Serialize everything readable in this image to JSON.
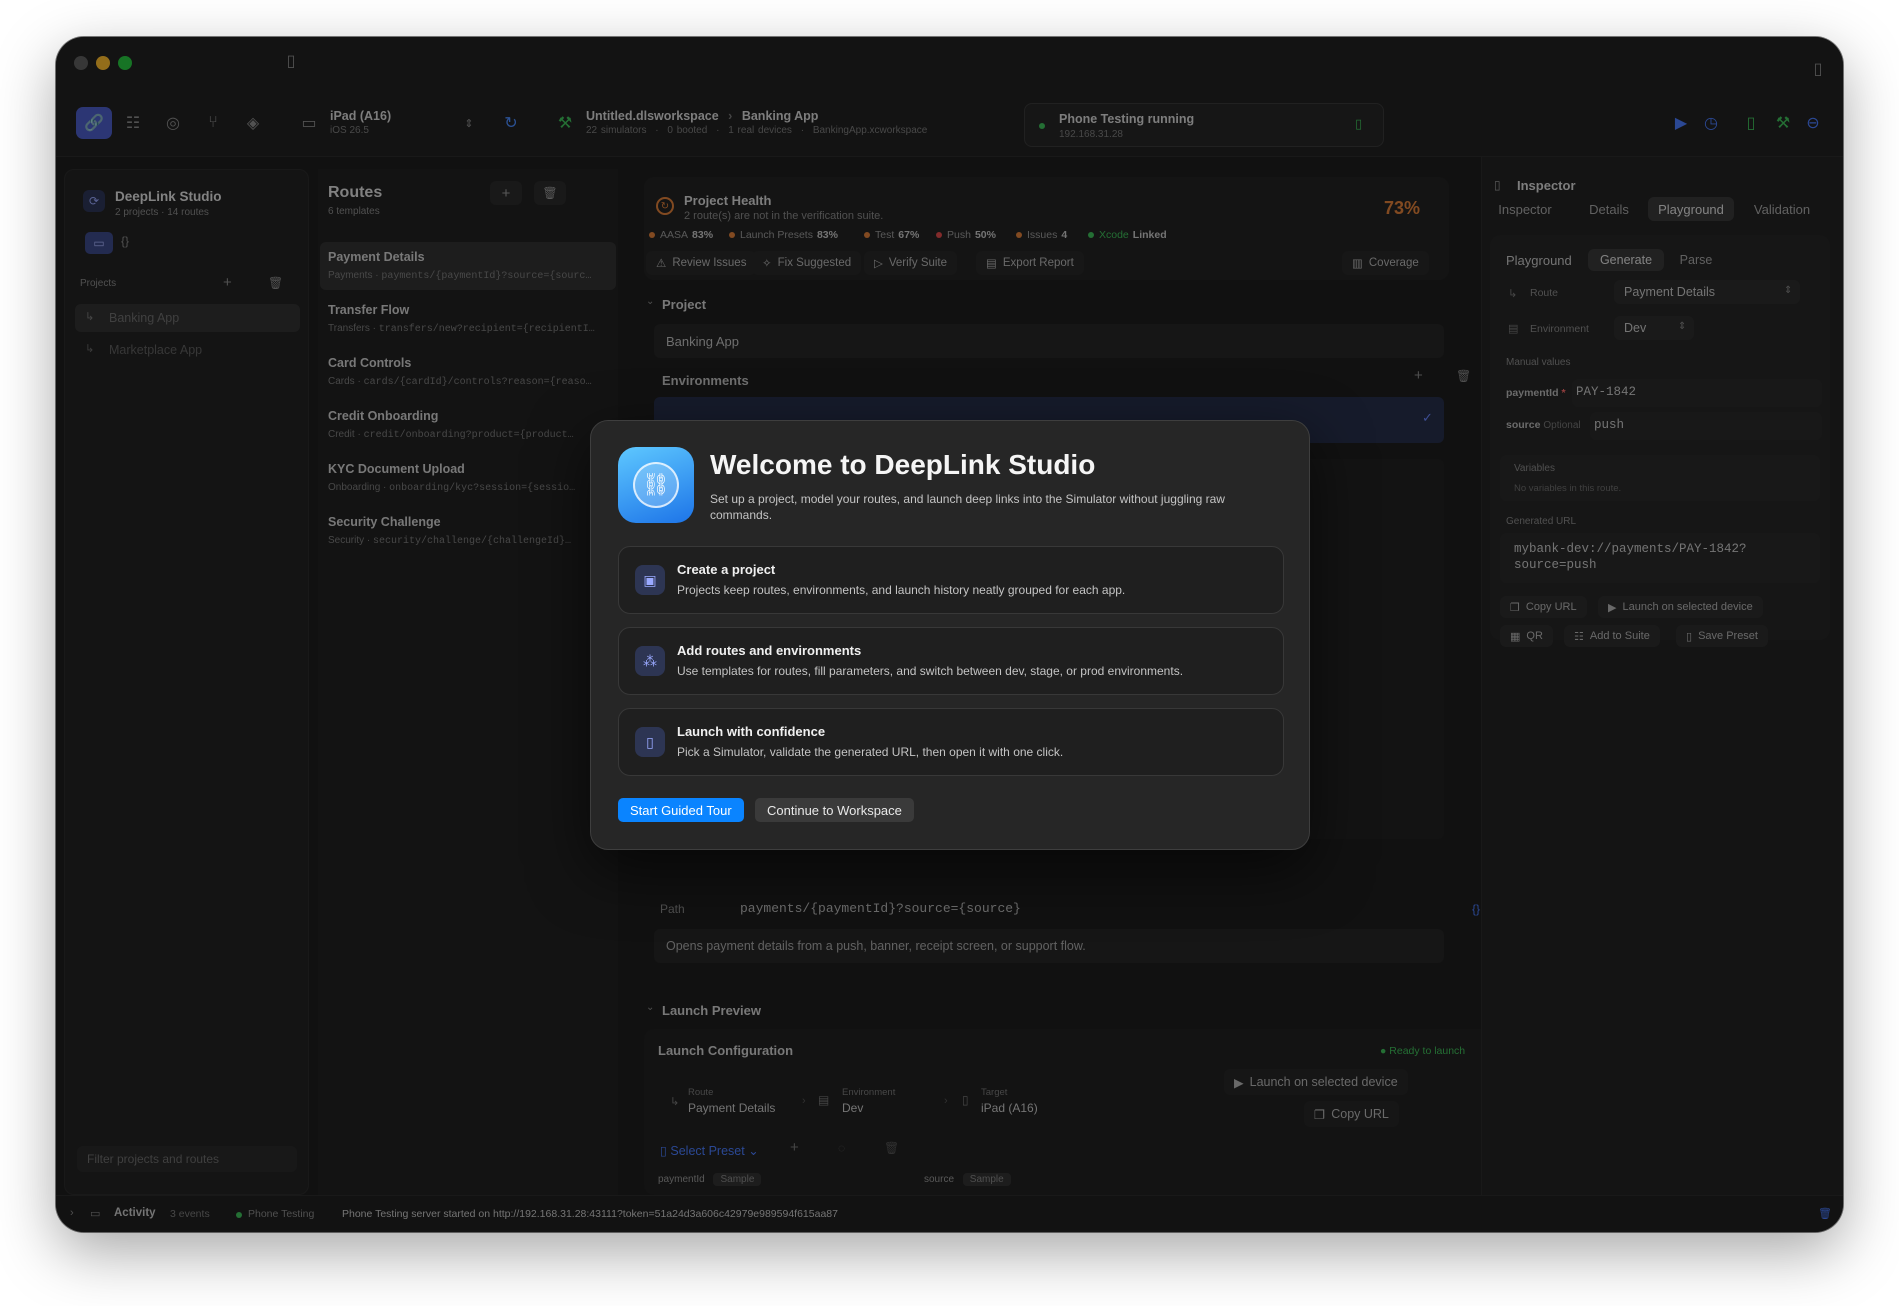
{
  "toolbar": {
    "device_name": "iPad (A16)",
    "device_os": "iOS 26.5",
    "workspace_title": "Untitled.dlsworkspace",
    "workspace_app": "Banking App",
    "workspace_meta": [
      "22 simulators",
      "0 booted",
      "1 real devices",
      "BankingApp.xcworkspace"
    ],
    "status_title": "Phone Testing running",
    "status_ip": "192.168.31.28"
  },
  "sidebar": {
    "app_title": "DeepLink Studio",
    "app_subtitle": "2 projects · 14 routes",
    "projects_label": "Projects",
    "projects": [
      {
        "label": "Banking App"
      },
      {
        "label": "Marketplace App"
      }
    ],
    "filter_placeholder": "Filter projects and routes"
  },
  "routes": {
    "title": "Routes",
    "subtitle": "6 templates",
    "items": [
      {
        "name": "Payment Details",
        "category": "Payments",
        "path": "payments/{paymentId}?source={sourc…"
      },
      {
        "name": "Transfer Flow",
        "category": "Transfers",
        "path": "transfers/new?recipient={recipientI…"
      },
      {
        "name": "Card Controls",
        "category": "Cards",
        "path": "cards/{cardId}/controls?reason={reaso…"
      },
      {
        "name": "Credit Onboarding",
        "category": "Credit",
        "path": "credit/onboarding?product={product…"
      },
      {
        "name": "KYC Document Upload",
        "category": "Onboarding",
        "path": "onboarding/kyc?session={sessio…"
      },
      {
        "name": "Security Challenge",
        "category": "Security",
        "path": "security/challenge/{challengeId}…"
      }
    ]
  },
  "health": {
    "title": "Project Health",
    "subtitle": "2 route(s) are not in the verification suite.",
    "percent": "73%",
    "metrics": [
      {
        "label": "AASA",
        "value": "83%",
        "color": "#e0803a"
      },
      {
        "label": "Launch Presets",
        "value": "83%",
        "color": "#e0803a"
      },
      {
        "label": "Test",
        "value": "67%",
        "color": "#e0803a"
      },
      {
        "label": "Push",
        "value": "50%",
        "color": "#e04a4a"
      },
      {
        "label": "Issues",
        "value": "4",
        "color": "#e0803a"
      },
      {
        "label": "Xcode",
        "value": "Linked",
        "color": "#3fbf5a"
      }
    ],
    "actions": [
      "Review Issues",
      "Fix Suggested",
      "Verify Suite",
      "Export Report"
    ],
    "coverage": "Coverage"
  },
  "project": {
    "section": "Project",
    "name": "Banking App",
    "environments": "Environments"
  },
  "route_detail": {
    "path_label": "Path",
    "path_value": "payments/{paymentId}?source={source}",
    "description": "Opens payment details from a push, banner, receipt screen, or support flow."
  },
  "launch": {
    "section": "Launch Preview",
    "config_title": "Launch Configuration",
    "ready": "Ready to launch",
    "route_label": "Route",
    "route_value": "Payment Details",
    "env_label": "Environment",
    "env_value": "Dev",
    "target_label": "Target",
    "target_value": "iPad (A16)",
    "launch_button": "Launch on selected device",
    "copy_button": "Copy URL",
    "preset": "Select Preset",
    "param1": "paymentId",
    "param1_tag": "Sample",
    "param2": "source",
    "param2_tag": "Sample"
  },
  "inspector": {
    "title": "Inspector",
    "tabs": [
      "Inspector",
      "Details",
      "Playground",
      "Validation"
    ],
    "playground_label": "Playground",
    "modes": [
      "Generate",
      "Parse"
    ],
    "route_label": "Route",
    "route_value": "Payment Details",
    "env_label": "Environment",
    "env_value": "Dev",
    "manual_values": "Manual values",
    "param1_name": "paymentId",
    "param1_value": "PAY-1842",
    "param2_name": "source",
    "param2_opt": "Optional",
    "param2_value": "push",
    "variables_label": "Variables",
    "variables_empty": "No variables in this route.",
    "generated_label": "Generated URL",
    "generated_line1": "mybank-dev://payments/PAY-1842?",
    "generated_line2": "source=push",
    "btn_copy": "Copy URL",
    "btn_launch": "Launch on selected device",
    "btn_qr": "QR",
    "btn_suite": "Add to Suite",
    "btn_preset": "Save Preset"
  },
  "statusbar": {
    "activity": "Activity",
    "events": "3 events",
    "phone": "Phone Testing",
    "message": "Phone Testing server started on http://192.168.31.28:43111?token=51a24d3a606c42979e989594f615aa87"
  },
  "modal": {
    "title": "Welcome to DeepLink Studio",
    "subtitle": "Set up a project, model your routes, and launch deep links into the Simulator without juggling raw commands.",
    "cards": [
      {
        "title": "Create a project",
        "desc": "Projects keep routes, environments, and launch history neatly grouped for each app.",
        "icon": "tray-icon"
      },
      {
        "title": "Add routes and environments",
        "desc": "Use templates for routes, fill parameters, and switch between dev, stage, or prod environments.",
        "icon": "nodes-icon"
      },
      {
        "title": "Launch with confidence",
        "desc": "Pick a Simulator, validate the generated URL, then open it with one click.",
        "icon": "device-icon"
      }
    ],
    "primary": "Start Guided Tour",
    "secondary": "Continue to Workspace"
  },
  "colors": {
    "accent": "#0a84ff",
    "warning": "#e0803a",
    "success": "#3fbf5a",
    "danger": "#e04a4a"
  }
}
